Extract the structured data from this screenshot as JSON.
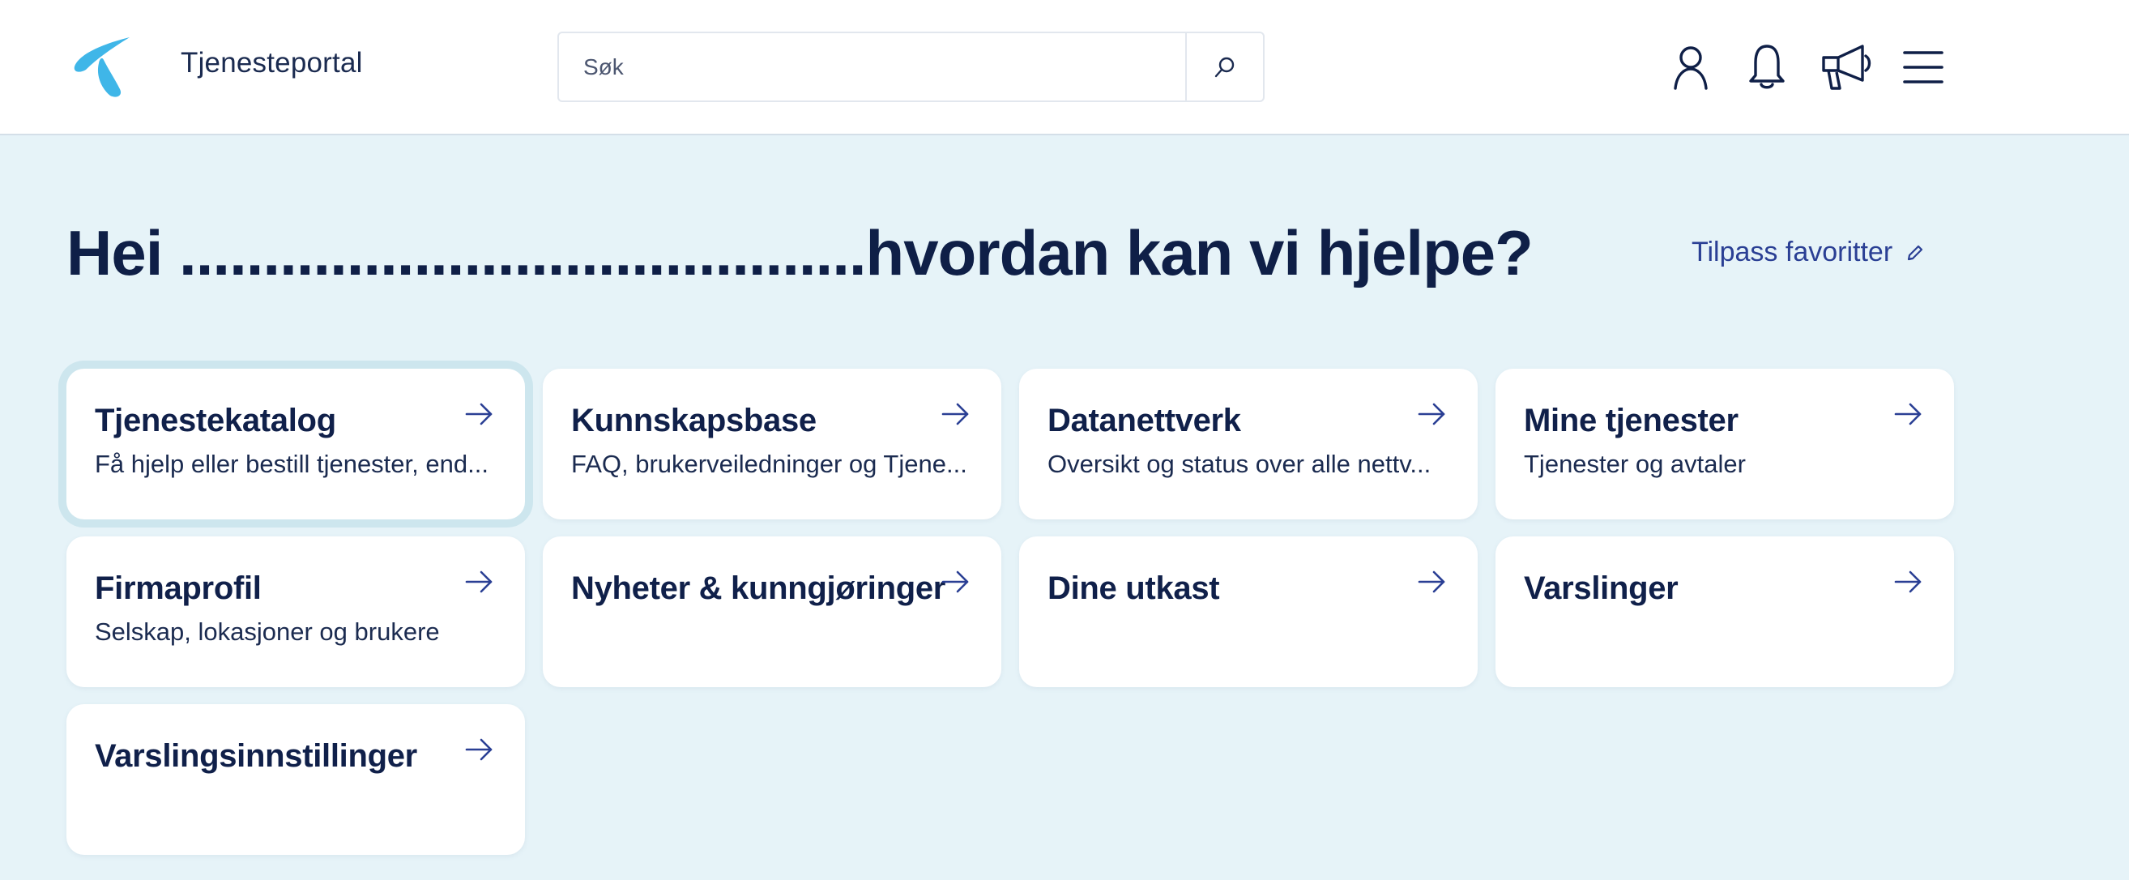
{
  "header": {
    "portal_title": "Tjenesteportal",
    "search_placeholder": "Søk",
    "icons": [
      "user-icon",
      "bell-icon",
      "megaphone-icon",
      "hamburger-menu-icon"
    ],
    "brand_color": "#3fb6e8"
  },
  "main": {
    "greeting": "Hei .........................................hvordan kan vi hjelpe?",
    "customize_label": "Tilpass favoritter",
    "background": "#e6f3f8",
    "cards": [
      {
        "title": "Tjenestekatalog",
        "subtitle": "Få hjelp eller bestill tjenester, end..."
      },
      {
        "title": "Kunnskapsbase",
        "subtitle": "FAQ, brukerveiledninger og Tjene..."
      },
      {
        "title": "Datanettverk",
        "subtitle": "Oversikt og status over alle nettv..."
      },
      {
        "title": "Mine tjenester",
        "subtitle": "Tjenester og avtaler"
      },
      {
        "title": "Firmaprofil",
        "subtitle": "Selskap, lokasjoner og brukere"
      },
      {
        "title": "Nyheter & kunngjøringer",
        "subtitle": ""
      },
      {
        "title": "Dine utkast",
        "subtitle": ""
      },
      {
        "title": "Varslinger",
        "subtitle": ""
      },
      {
        "title": "Varslingsinnstillinger",
        "subtitle": ""
      }
    ]
  }
}
